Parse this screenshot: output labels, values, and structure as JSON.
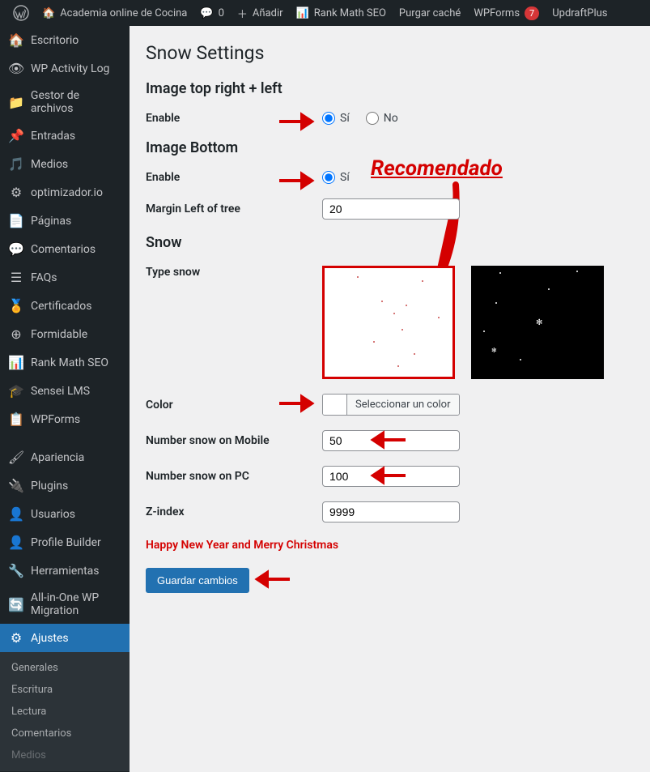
{
  "adminbar": {
    "site_name": "Academia online de Cocina",
    "comments": "0",
    "add": "Añadir",
    "rankmath": "Rank Math SEO",
    "purge": "Purgar caché",
    "wpforms": "WPForms",
    "wpforms_badge": "7",
    "updraft": "UpdraftPlus"
  },
  "sidebar": {
    "items": [
      {
        "label": "Escritorio",
        "icon": "dashboard"
      },
      {
        "label": "WP Activity Log",
        "icon": "activity"
      },
      {
        "label": "Gestor de archivos",
        "icon": "folder"
      },
      {
        "label": "Entradas",
        "icon": "pin"
      },
      {
        "label": "Medios",
        "icon": "media"
      },
      {
        "label": "optimizador.io",
        "icon": "opt"
      },
      {
        "label": "Páginas",
        "icon": "pages"
      },
      {
        "label": "Comentarios",
        "icon": "comments"
      },
      {
        "label": "FAQs",
        "icon": "faqs"
      },
      {
        "label": "Certificados",
        "icon": "cert"
      },
      {
        "label": "Formidable",
        "icon": "form"
      },
      {
        "label": "Rank Math SEO",
        "icon": "rankmath"
      },
      {
        "label": "Sensei LMS",
        "icon": "sensei"
      },
      {
        "label": "WPForms",
        "icon": "wpforms"
      },
      {
        "label": "Apariencia",
        "icon": "appearance"
      },
      {
        "label": "Plugins",
        "icon": "plugins"
      },
      {
        "label": "Usuarios",
        "icon": "users"
      },
      {
        "label": "Profile Builder",
        "icon": "profile"
      },
      {
        "label": "Herramientas",
        "icon": "tools"
      },
      {
        "label": "All-in-One WP Migration",
        "icon": "migration"
      },
      {
        "label": "Ajustes",
        "icon": "settings",
        "current": true
      }
    ],
    "submenu": [
      "Generales",
      "Escritura",
      "Lectura",
      "Comentarios",
      "Medios"
    ]
  },
  "page": {
    "title": "Snow Settings",
    "section_top": "Image top right + left",
    "section_bottom": "Image Bottom",
    "section_snow": "Snow",
    "enable_label": "Enable",
    "yes": "Sí",
    "no": "No",
    "margin_left_label": "Margin Left of tree",
    "margin_left_value": "20",
    "type_snow_label": "Type snow",
    "color_label": "Color",
    "color_select": "Seleccionar un color",
    "num_mobile_label": "Number snow on Mobile",
    "num_mobile_value": "50",
    "num_pc_label": "Number snow on PC",
    "num_pc_value": "100",
    "zindex_label": "Z-index",
    "zindex_value": "9999",
    "happy": "Happy New Year and Merry Christmas",
    "save": "Guardar cambios",
    "recomendado": "Recomendado"
  }
}
